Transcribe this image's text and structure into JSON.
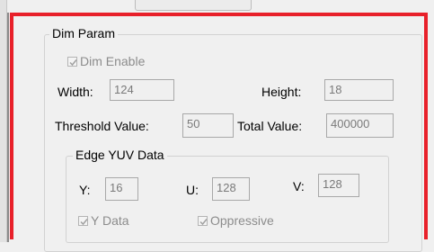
{
  "dim_param": {
    "title": "Dim Param",
    "dim_enable": {
      "label": "Dim Enable",
      "checked": true,
      "disabled": true
    },
    "width": {
      "label": "Width:",
      "value": "124"
    },
    "height": {
      "label": "Height:",
      "value": "18"
    },
    "threshold": {
      "label": "Threshold Value:",
      "value": "50"
    },
    "total": {
      "label": "Total Value:",
      "value": "400000"
    },
    "edge_yuv": {
      "title": "Edge YUV Data",
      "y": {
        "label": "Y:",
        "value": "16"
      },
      "u": {
        "label": "U:",
        "value": "128"
      },
      "v": {
        "label": "V:",
        "value": "128"
      },
      "y_data": {
        "label": "Y Data",
        "checked": true,
        "disabled": true
      },
      "oppressive": {
        "label": "Oppressive",
        "checked": true,
        "disabled": true
      }
    }
  },
  "colors": {
    "highlight_frame": "#e8202a",
    "disabled_text": "#8c8c8c"
  }
}
